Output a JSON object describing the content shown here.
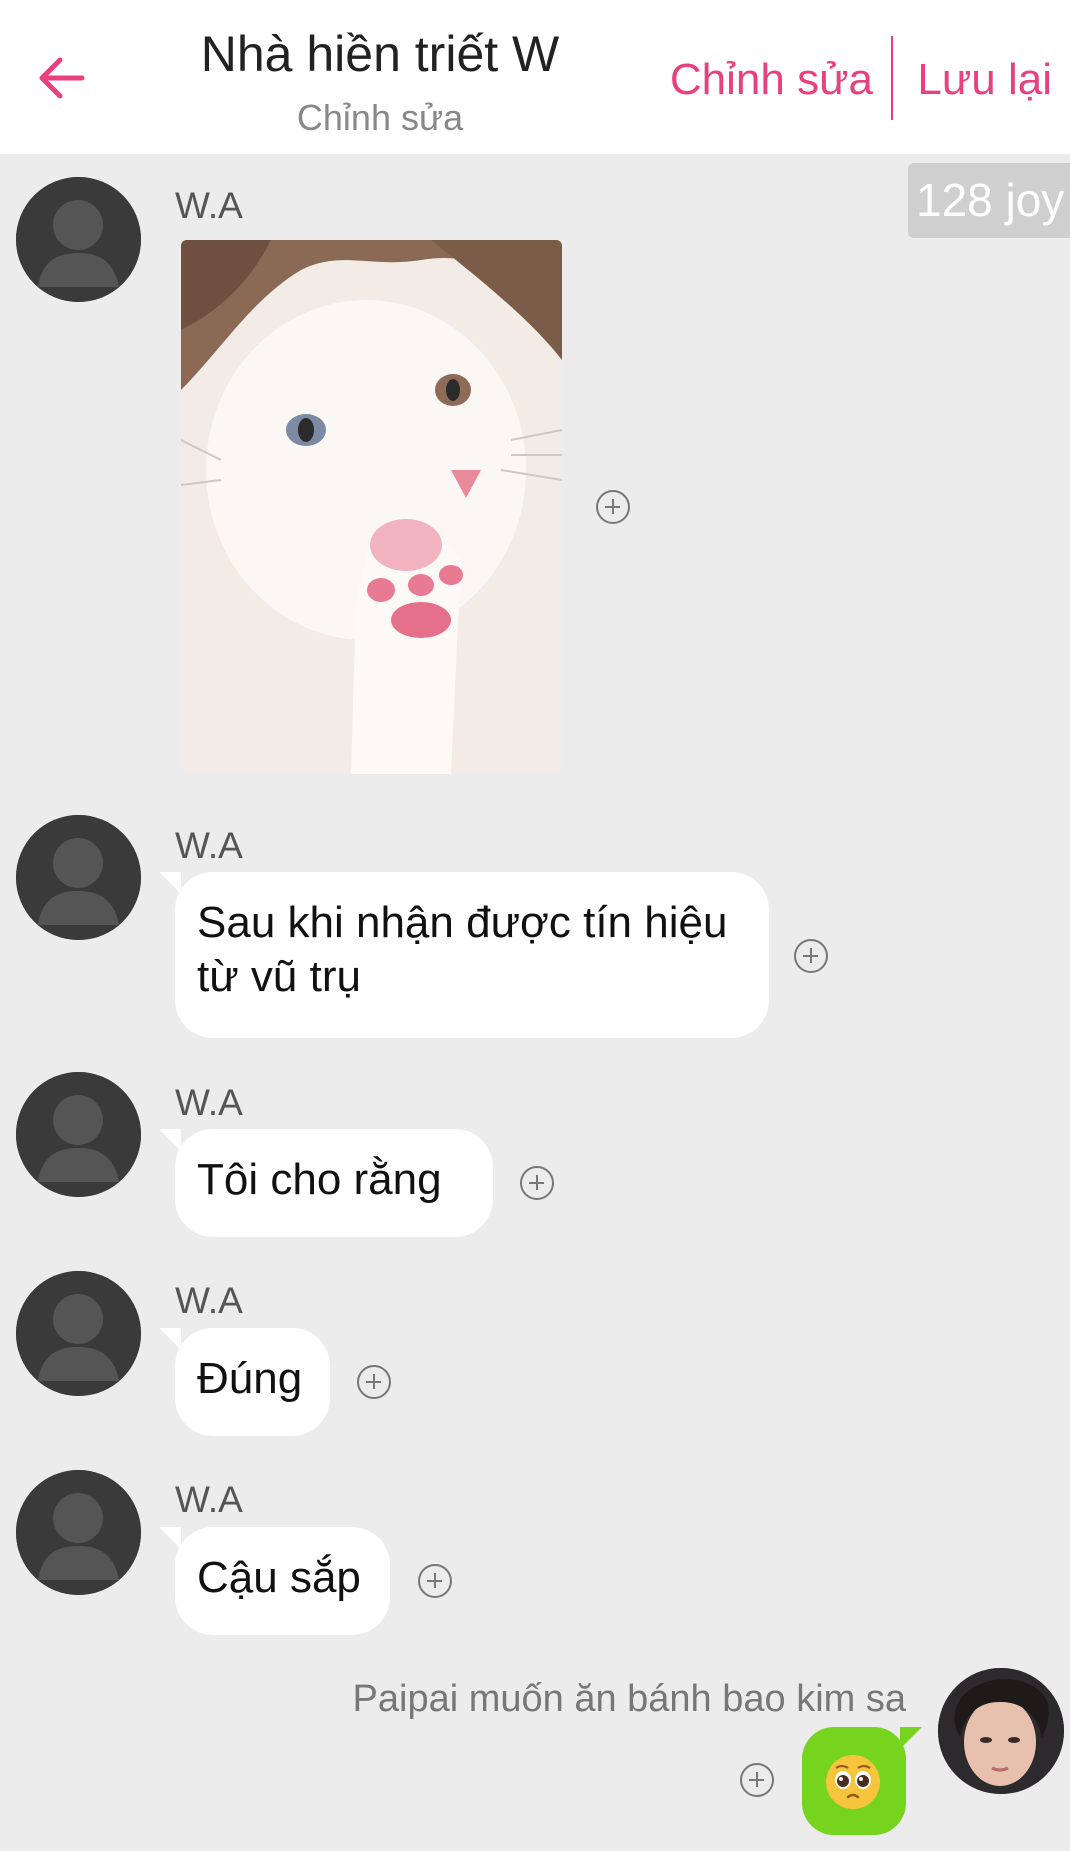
{
  "header": {
    "title": "Nhà hiền triết W",
    "subtitle": "Chỉnh sửa",
    "edit_label": "Chỉnh sửa",
    "save_label": "Lưu lại",
    "accent_color": "#e8417e"
  },
  "joy_badge": "128 joy",
  "messages": [
    {
      "sender": "W.A",
      "type": "image",
      "image": "cat-biting-paw"
    },
    {
      "sender": "W.A",
      "type": "text",
      "text": "Sau khi nhận được tín hiệu từ vũ trụ"
    },
    {
      "sender": "W.A",
      "type": "text",
      "text": "Tôi cho rằng"
    },
    {
      "sender": "W.A",
      "type": "text",
      "text": "Đúng"
    },
    {
      "sender": "W.A",
      "type": "text",
      "text": "Cậu sắp"
    }
  ],
  "my_message": {
    "sender": "Paipai muốn ăn bánh bao kim sa",
    "type": "emoji",
    "emoji": "🥺",
    "bubble_color": "#77d41e"
  },
  "icons": [
    "back-arrow-icon",
    "avatar-placeholder-icon",
    "add-reaction-icon",
    "pleading-face-icon"
  ]
}
